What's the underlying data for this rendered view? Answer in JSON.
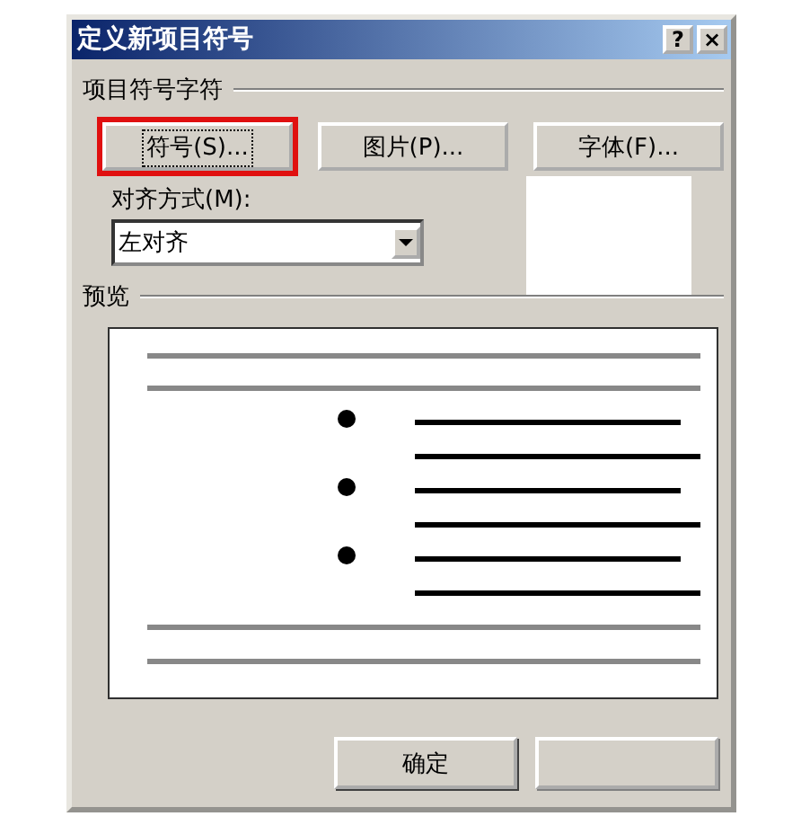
{
  "window": {
    "title": "定义新项目符号",
    "title_buttons": [
      "?",
      "×"
    ]
  },
  "bullet_group": {
    "label": "项目符号字符",
    "buttons": [
      {
        "label": "符号(S)...",
        "highlighted": true,
        "focused": true
      },
      {
        "label": "图片(P)...",
        "highlighted": false,
        "focused": false
      },
      {
        "label": "字体(F)...",
        "highlighted": false,
        "focused": false
      }
    ]
  },
  "alignment": {
    "label": "对齐方式(M):",
    "value": "左对齐"
  },
  "preview": {
    "label": "预览"
  },
  "footer_buttons": [
    {
      "kind": "ok",
      "label": "确定"
    },
    {
      "kind": "cancel"
    }
  ]
}
